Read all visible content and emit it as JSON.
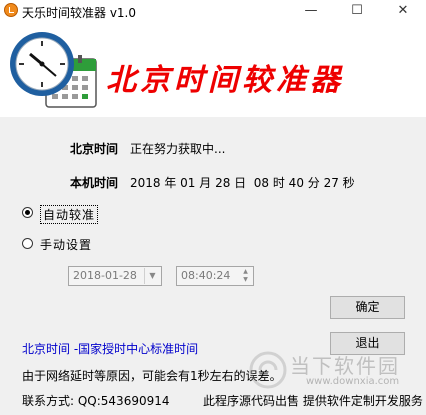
{
  "window": {
    "title": "天乐时间较准器 v1.0",
    "minimize": "—",
    "maximize": "☐",
    "close": "✕"
  },
  "header": {
    "title": "北京时间较准器"
  },
  "beijing_time": {
    "label": "北京时间",
    "value": "正在努力获取中..."
  },
  "local_time": {
    "label": "本机时间",
    "value": "2018 年 01 月 28 日  08 时 40 分 27 秒"
  },
  "mode": {
    "auto_label": "自动较准",
    "manual_label": "手动设置",
    "selected": "auto"
  },
  "manual": {
    "date_value": "2018-01-28",
    "time_value": "08:40:24"
  },
  "buttons": {
    "confirm": "确定",
    "exit": "退出"
  },
  "link": {
    "text": "北京时间 -国家授时中心标准时间"
  },
  "note": {
    "text": "由于网络延时等原因，可能会有1秒左右的误差。"
  },
  "footer": {
    "contact": "联系方式:  QQ:543690914",
    "source": "此程序源代码出售  提供软件定制开发服务"
  },
  "watermark": {
    "brand": "当下软件园",
    "url": "www.downxia.com"
  },
  "colors": {
    "header_title": "#ee0000",
    "link": "#0000cc",
    "clock_face": "#1f5fa0",
    "calendar": "#2e9d3a"
  }
}
